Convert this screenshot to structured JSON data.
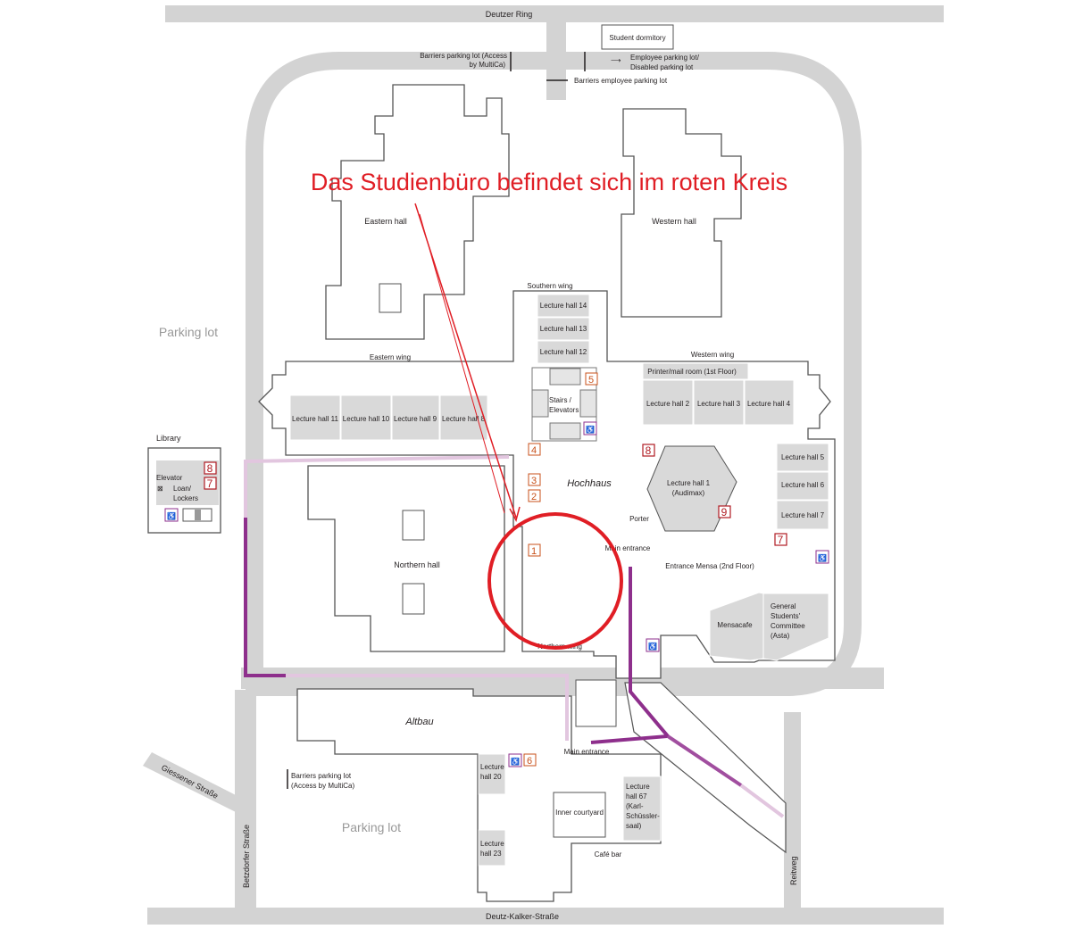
{
  "streets": {
    "top": "Deutzer Ring",
    "bottom": "Deutz-Kalker-Straße",
    "left_diag": "Giessener Straße",
    "left_vert": "Betzdorfer Straße",
    "right_vert": "Reitweg"
  },
  "annotation": {
    "text": "Das Studienbüro befindet sich im roten Kreis",
    "color": "#e01e25"
  },
  "labels": {
    "student_dormitory": "Student dormitory",
    "barriers_access_1": "Barriers parking lot (Access",
    "barriers_access_2": "by MultiCa)",
    "employee_parking_1": "Employee parking lot/",
    "employee_parking_2": "Disabled parking lot",
    "barriers_employee": "Barriers employee parking lot",
    "eastern_hall": "Eastern hall",
    "western_hall": "Western hall",
    "parking_lot_top": "Parking lot",
    "parking_lot_bottom": "Parking lot",
    "southern_wing": "Southern wing",
    "eastern_wing": "Eastern wing",
    "western_wing": "Western wing",
    "northern_wing": "Northern wing",
    "stairs_1": "Stairs /",
    "stairs_2": "Elevators",
    "printer": "Printer/mail room (1st Floor)",
    "library": "Library",
    "elevator": "Elevator",
    "loan_1": "Loan/",
    "loan_2": "Lockers",
    "hochhaus": "Hochhaus",
    "northern_hall": "Northern hall",
    "audimax_1": "Lecture hall 1",
    "audimax_2": "(Audimax)",
    "porter": "Porter",
    "main_entrance_top": "Main entrance",
    "entrance_mensa": "Entrance Mensa (2nd Floor)",
    "mensacafe": "Mensacafe",
    "asta_1": "General",
    "asta_2": "Students'",
    "asta_3": "Committee",
    "asta_4": "(Asta)",
    "altbau": "Altbau",
    "main_entrance_bottom": "Main entrance",
    "barriers_bottom_1": "Barriers parking lot",
    "barriers_bottom_2": "(Access by MultiCa)",
    "inner_courtyard": "Inner courtyard",
    "cafe_bar": "Café bar",
    "lh20_1": "Lecture",
    "lh20_2": "hall 20",
    "lh23_1": "Lecture",
    "lh23_2": "hall  23",
    "lh67_1": "Lecture",
    "lh67_2": "hall 67",
    "lh67_3": "(Karl-",
    "lh67_4": "Schüssler-",
    "lh67_5": "saal)"
  },
  "lecture_halls": {
    "lh14": "Lecture hall 14",
    "lh13": "Lecture hall 13",
    "lh12": "Lecture hall 12",
    "lh11": "Lecture hall 11",
    "lh10": "Lecture hall 10",
    "lh9": "Lecture hall 9",
    "lh8": "Lecture hall 8",
    "lh2": "Lecture hall 2",
    "lh3": "Lecture hall 3",
    "lh4": "Lecture hall 4",
    "lh5": "Lecture hall 5",
    "lh6": "Lecture hall 6",
    "lh7": "Lecture hall 7"
  },
  "markers": {
    "m1": "1",
    "m2": "2",
    "m3": "3",
    "m4": "4",
    "m5": "5",
    "m6a": "6",
    "m6b": "6",
    "m7a": "7",
    "m7b": "7",
    "m8a": "8",
    "m8b": "8",
    "m9": "9"
  },
  "colors": {
    "road": "#d3d3d3",
    "route_purple": "#8e2f8c",
    "route_light": "#e2c6df",
    "marker_orange": "#c8521b",
    "marker_red": "#b01c23",
    "hall_fill": "#d9d9d9"
  },
  "icons": [
    "accessible-icon",
    "elevator-icon",
    "accessible-parking-icon",
    "stairs-icon",
    "door-icon"
  ]
}
